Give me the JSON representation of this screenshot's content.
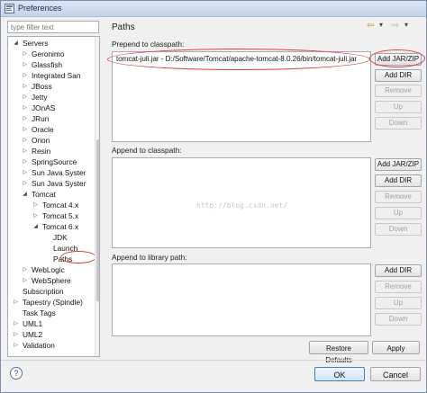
{
  "window": {
    "title": "Preferences"
  },
  "filter": {
    "placeholder": "type filter text"
  },
  "tree": [
    {
      "label": "Servers",
      "twisty": "◢"
    },
    {
      "label": "Geronimo",
      "twisty": "▷"
    },
    {
      "label": "Glassfish",
      "twisty": "▷"
    },
    {
      "label": "Integrated San",
      "twisty": "▷"
    },
    {
      "label": "JBoss",
      "twisty": "▷"
    },
    {
      "label": "Jetty",
      "twisty": "▷"
    },
    {
      "label": "JOnAS",
      "twisty": "▷"
    },
    {
      "label": "JRun",
      "twisty": "▷"
    },
    {
      "label": "Oracle",
      "twisty": "▷"
    },
    {
      "label": "Orion",
      "twisty": "▷"
    },
    {
      "label": "Resin",
      "twisty": "▷"
    },
    {
      "label": "SpringSource",
      "twisty": "▷"
    },
    {
      "label": "Sun Java Syster",
      "twisty": "▷"
    },
    {
      "label": "Sun Java Syster",
      "twisty": "▷"
    },
    {
      "label": "Tomcat",
      "twisty": "◢"
    },
    {
      "label": "Tomcat  4.x",
      "twisty": "▷"
    },
    {
      "label": "Tomcat  5.x",
      "twisty": "▷"
    },
    {
      "label": "Tomcat  6.x",
      "twisty": "◢"
    },
    {
      "label": "JDK",
      "twisty": ""
    },
    {
      "label": "Launch",
      "twisty": ""
    },
    {
      "label": "Paths",
      "twisty": ""
    },
    {
      "label": "WebLogic",
      "twisty": "▷"
    },
    {
      "label": "WebSphere",
      "twisty": "▷"
    },
    {
      "label": "Subscription",
      "twisty": ""
    },
    {
      "label": "Tapestry (Spindle)",
      "twisty": "▷"
    },
    {
      "label": "Task Tags",
      "twisty": ""
    },
    {
      "label": "UML1",
      "twisty": "▷"
    },
    {
      "label": "UML2",
      "twisty": "▷"
    },
    {
      "label": "Validation",
      "twisty": "▷"
    },
    {
      "label": "...",
      "twisty": ""
    }
  ],
  "page": {
    "title": "Paths"
  },
  "prepend": {
    "label": "Prepend to classpath:",
    "entries": [
      "tomcat-juli.jar - D:/Software/Tomcat/apache-tomcat-8.0.26/bin/tomcat-juli.jar"
    ],
    "buttons": {
      "add_jar": "Add JAR/ZIP",
      "add_dir": "Add DIR",
      "remove": "Remove",
      "up": "Up",
      "down": "Down"
    }
  },
  "append_classpath": {
    "label": "Append to classpath:",
    "buttons": {
      "add_jar": "Add JAR/ZIP",
      "add_dir": "Add DIR",
      "remove": "Remove",
      "up": "Up",
      "down": "Down"
    }
  },
  "append_library": {
    "label": "Append to library path:",
    "buttons": {
      "add_dir": "Add DIR",
      "remove": "Remove",
      "up": "Up",
      "down": "Down"
    }
  },
  "watermark": "http://blog.csdn.net/",
  "footer": {
    "restore": "Restore Defaults",
    "apply": "Apply",
    "ok": "OK",
    "cancel": "Cancel",
    "help": "?"
  },
  "nav_icons": {
    "back": "⇦",
    "menu_a": "▾",
    "forward": "⇨",
    "menu_b": "▾"
  },
  "colors": {
    "highlight_circle": "#d94040",
    "accent": "#3c7fc4"
  }
}
